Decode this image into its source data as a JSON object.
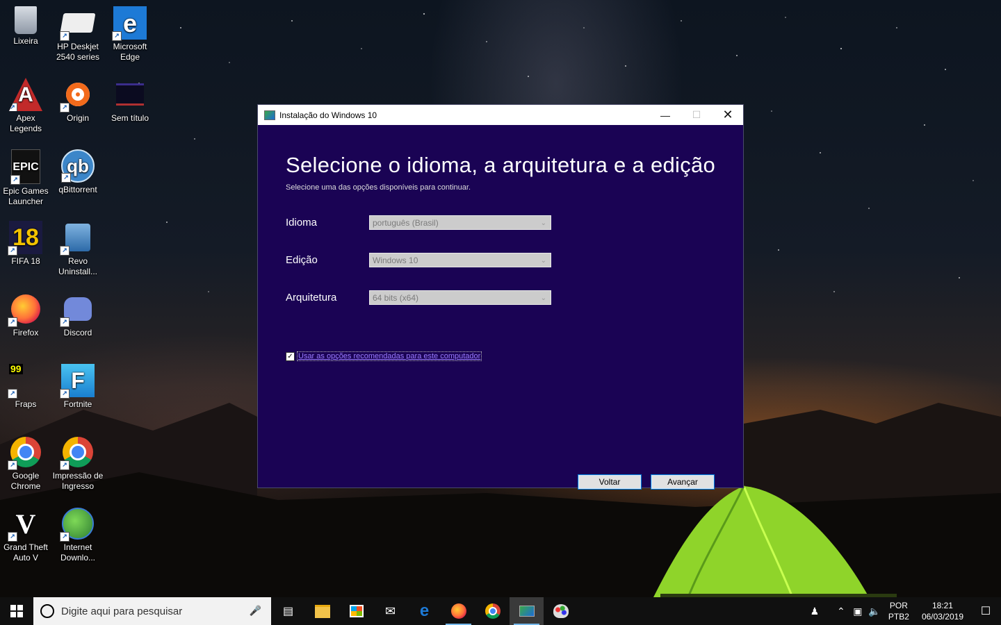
{
  "desktop": {
    "icons": [
      {
        "label": "Lixeira",
        "icon": "recycle-bin-icon"
      },
      {
        "label": "HP Deskjet 2540 series",
        "icon": "printer-icon"
      },
      {
        "label": "Microsoft Edge",
        "icon": "edge-icon"
      },
      {
        "label": "Apex Legends",
        "icon": "apex-icon"
      },
      {
        "label": "Origin",
        "icon": "origin-icon"
      },
      {
        "label": "Sem título",
        "icon": "image-file-icon"
      },
      {
        "label": "Epic Games Launcher",
        "icon": "epic-games-icon"
      },
      {
        "label": "qBittorrent",
        "icon": "qbittorrent-icon"
      },
      {
        "label": "FIFA 18",
        "icon": "fifa-icon"
      },
      {
        "label": "Revo Uninstall...",
        "icon": "revo-icon"
      },
      {
        "label": "Firefox",
        "icon": "firefox-icon"
      },
      {
        "label": "Discord",
        "icon": "discord-icon"
      },
      {
        "label": "Fraps",
        "icon": "fraps-icon"
      },
      {
        "label": "Fortnite",
        "icon": "fortnite-icon"
      },
      {
        "label": "Google Chrome",
        "icon": "chrome-icon"
      },
      {
        "label": "Impressão de Ingresso",
        "icon": "chrome-icon"
      },
      {
        "label": "Grand Theft Auto V",
        "icon": "gta-icon"
      },
      {
        "label": "Internet Downlo...",
        "icon": "idm-icon"
      }
    ],
    "fifa_badge": "18",
    "fraps_badge": "99",
    "epic_badge": "EPIC",
    "qb_badge": "qb",
    "edge_badge": "e",
    "fortnite_badge": "F",
    "gta_badge": "V"
  },
  "window": {
    "title": "Instalação do Windows 10",
    "heading": "Selecione o idioma, a arquitetura e a edição",
    "subheading": "Selecione uma das opções disponíveis para continuar.",
    "fields": [
      {
        "label": "Idioma",
        "value": "português (Brasil)"
      },
      {
        "label": "Edição",
        "value": "Windows 10"
      },
      {
        "label": "Arquitetura",
        "value": "64 bits (x64)"
      }
    ],
    "checkbox_label": "Usar as opções recomendadas para este computador",
    "checkbox_checked": true,
    "back_label": "Voltar",
    "next_label": "Avançar",
    "bg_color": "#1a0354"
  },
  "taskbar": {
    "search_placeholder": "Digite aqui para pesquisar",
    "apps": [
      "task-view-icon",
      "file-explorer-icon",
      "store-icon",
      "mail-icon",
      "edge-icon",
      "firefox-icon",
      "chrome-icon",
      "media-creation-tool-icon",
      "paint-icon"
    ],
    "lang_top": "POR",
    "lang_bottom": "PTB2",
    "time": "18:21",
    "date": "06/03/2019"
  }
}
